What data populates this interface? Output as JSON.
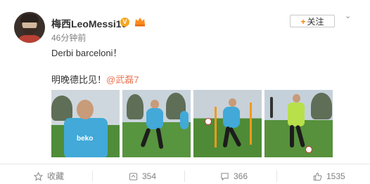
{
  "user": {
    "name": "梅西LeoMessi10",
    "verified_mark": "V"
  },
  "post": {
    "timestamp": "46分钟前",
    "text_line1": "Derbi barceloni！",
    "text_line2_prefix": "明晚德比见！",
    "mention": "@武磊7"
  },
  "follow_button": {
    "plus": "+",
    "label": "关注"
  },
  "actions": {
    "favorite": {
      "label": "收藏",
      "icon": "star-icon"
    },
    "repost": {
      "count": "354",
      "icon": "repost-icon"
    },
    "comment": {
      "count": "366",
      "icon": "comment-icon"
    },
    "like": {
      "count": "1535",
      "icon": "thumbs-up-icon"
    }
  },
  "photos": [
    {
      "logo": "beko"
    },
    {},
    {},
    {}
  ],
  "colors": {
    "accent": "#ff8200",
    "mention": "#eb7350",
    "muted": "#808080"
  }
}
